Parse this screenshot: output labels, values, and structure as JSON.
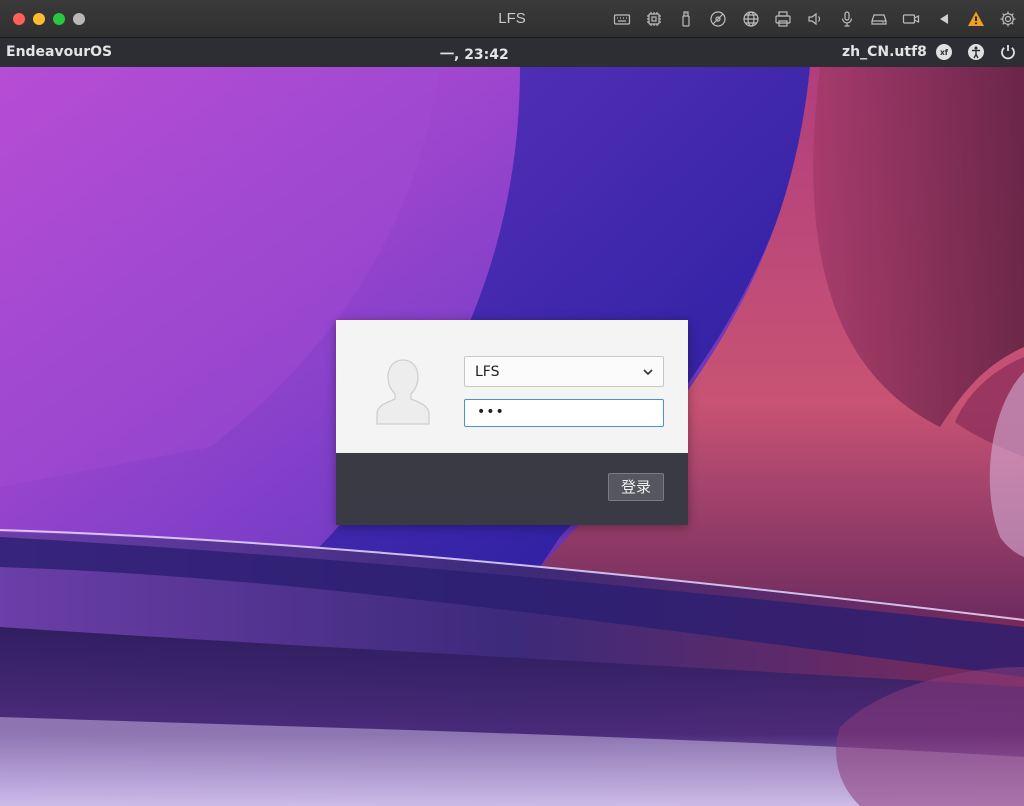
{
  "window": {
    "title": "LFS",
    "toolbar_icons": [
      "keyboard-icon",
      "cpu-icon",
      "usb-icon",
      "disc-icon",
      "network-icon",
      "printer-icon",
      "speaker-icon",
      "microphone-icon",
      "drive-icon",
      "camera-icon",
      "play-left-icon",
      "warning-icon",
      "gear-icon"
    ]
  },
  "panel": {
    "hostname": "EndeavourOS",
    "clock": "一, 23:42",
    "locale": "zh_CN.utf8",
    "icons": [
      "keyboard-layout-icon",
      "accessibility-icon",
      "power-icon"
    ]
  },
  "login": {
    "username": "LFS",
    "password_mask": "•••",
    "login_button": "登录"
  },
  "colors": {
    "panel_bg": "#2c2e34",
    "dialog_top_bg": "#f4f4f5",
    "dialog_bottom_bg": "#393a43",
    "focus_border": "#4a90d9",
    "warning": "#f0a020"
  }
}
